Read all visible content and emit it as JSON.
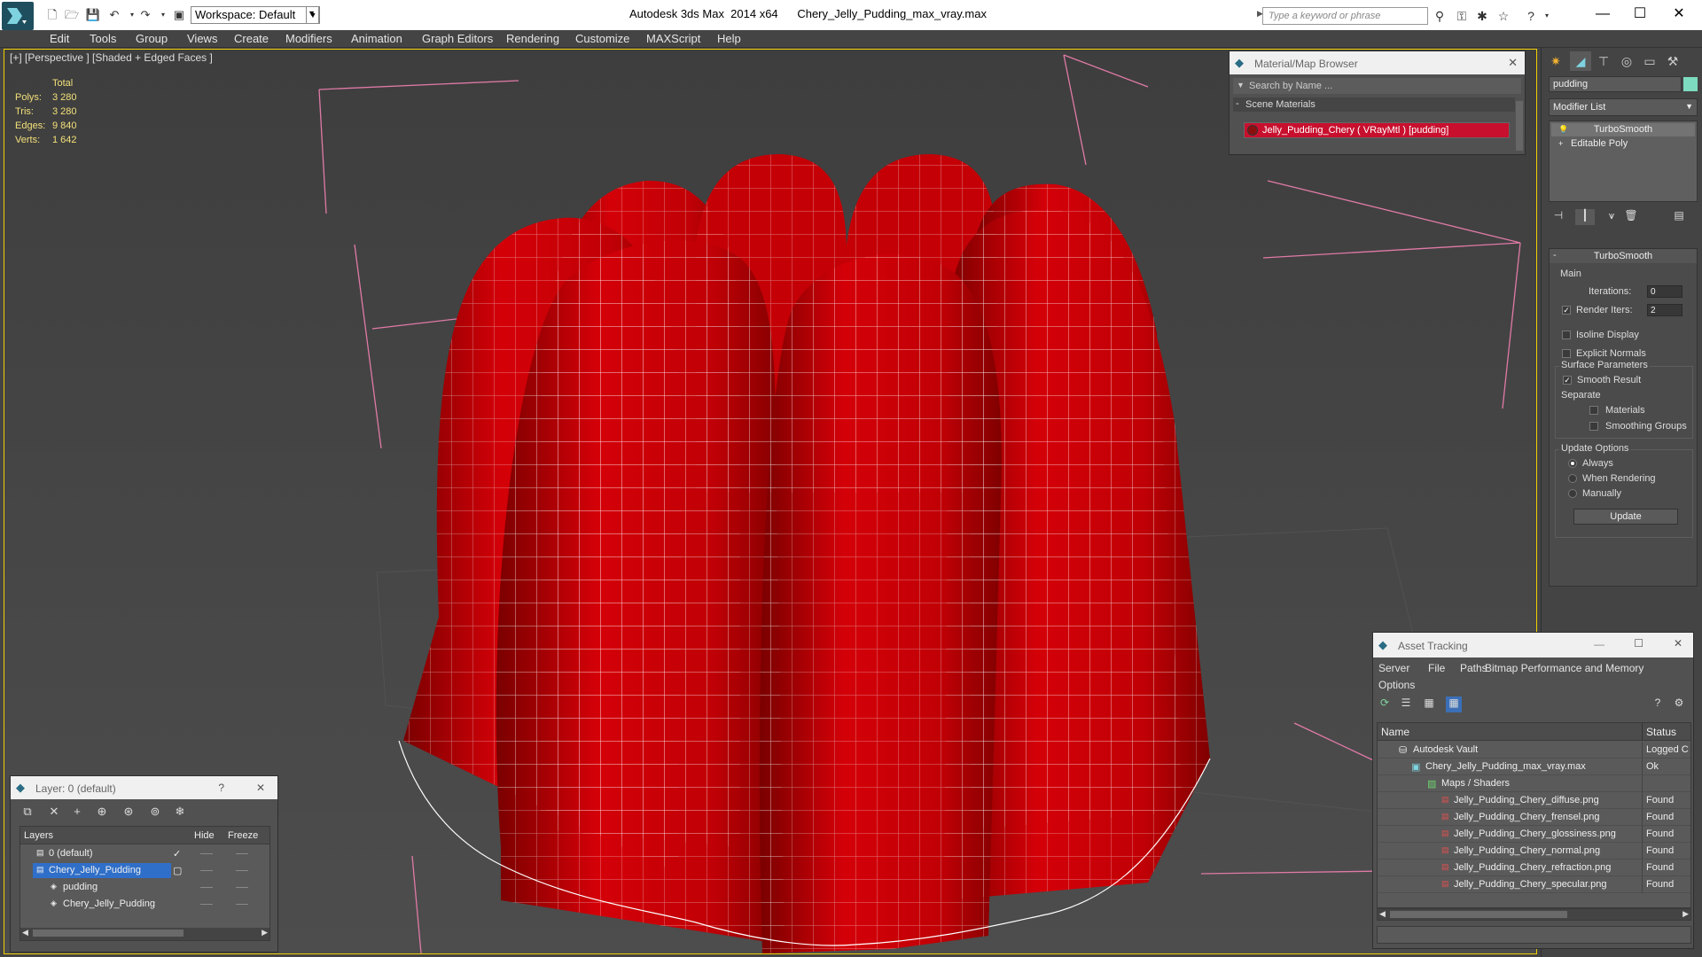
{
  "titlebar": {
    "app_title": "Autodesk 3ds Max  2014 x64      Chery_Jelly_Pudding_max_vray.max",
    "workspace": "Workspace: Default",
    "search_placeholder": "Type a keyword or phrase",
    "minimize": "—",
    "maximize": "☐",
    "close": "✕"
  },
  "menubar": [
    "Edit",
    "Tools",
    "Group",
    "Views",
    "Create",
    "Modifiers",
    "Animation",
    "Graph Editors",
    "Rendering",
    "Customize",
    "MAXScript",
    "Help"
  ],
  "viewport": {
    "label": "[+] [Perspective ] [Shaded + Edged Faces ]",
    "stats": {
      "total_label": "Total",
      "rows": [
        {
          "label": "Polys:",
          "value": "3 280"
        },
        {
          "label": "Tris:",
          "value": "3 280"
        },
        {
          "label": "Edges:",
          "value": "9 840"
        },
        {
          "label": "Verts:",
          "value": "1 642"
        }
      ]
    },
    "mesh_color": "#c8000a"
  },
  "material_browser": {
    "title": "Material/Map Browser",
    "search_placeholder": "Search by Name ...",
    "group": "Scene Materials",
    "item": "Jelly_Pudding_Chery  ( VRayMtl ) [pudding]"
  },
  "command_panel": {
    "object_name": "pudding",
    "modifier_list": "Modifier List",
    "stack": [
      "TurboSmooth",
      "Editable Poly"
    ],
    "turbosmooth": {
      "title": "TurboSmooth",
      "main": "Main",
      "iterations_label": "Iterations:",
      "iterations": "0",
      "render_iters_label": "Render Iters:",
      "render_iters": "2",
      "isoline": "Isoline Display",
      "explicit": "Explicit Normals",
      "surface": "Surface Parameters",
      "smooth_result": "Smooth Result",
      "separate": "Separate",
      "materials": "Materials",
      "smoothing_groups": "Smoothing Groups",
      "update_options": "Update Options",
      "always": "Always",
      "when_rendering": "When Rendering",
      "manually": "Manually",
      "update": "Update"
    }
  },
  "asset_tracking": {
    "title": "Asset Tracking",
    "menu": [
      "Server",
      "File",
      "Paths",
      "Bitmap Performance and Memory",
      "Options"
    ],
    "col_name": "Name",
    "col_status": "Status",
    "rows": [
      {
        "name": "Autodesk Vault",
        "status": "Logged C",
        "icon": "vault-icon"
      },
      {
        "name": "Chery_Jelly_Pudding_max_vray.max",
        "status": "Ok",
        "icon": "max-file-icon"
      },
      {
        "name": "Maps / Shaders",
        "status": "",
        "icon": "folder-icon"
      },
      {
        "name": "Jelly_Pudding_Chery_diffuse.png",
        "status": "Found",
        "icon": "png-icon"
      },
      {
        "name": "Jelly_Pudding_Chery_frensel.png",
        "status": "Found",
        "icon": "png-icon"
      },
      {
        "name": "Jelly_Pudding_Chery_glossiness.png",
        "status": "Found",
        "icon": "png-icon"
      },
      {
        "name": "Jelly_Pudding_Chery_normal.png",
        "status": "Found",
        "icon": "png-icon"
      },
      {
        "name": "Jelly_Pudding_Chery_refraction.png",
        "status": "Found",
        "icon": "png-icon"
      },
      {
        "name": "Jelly_Pudding_Chery_specular.png",
        "status": "Found",
        "icon": "png-icon"
      }
    ]
  },
  "layers": {
    "title": "Layer: 0 (default)",
    "help": "?",
    "close": "✕",
    "col_layers": "Layers",
    "col_hide": "Hide",
    "col_freeze": "Freeze",
    "rows": [
      {
        "name": "0 (default)"
      },
      {
        "name": "Chery_Jelly_Pudding"
      },
      {
        "name": "pudding"
      },
      {
        "name": "Chery_Jelly_Pudding"
      }
    ]
  }
}
